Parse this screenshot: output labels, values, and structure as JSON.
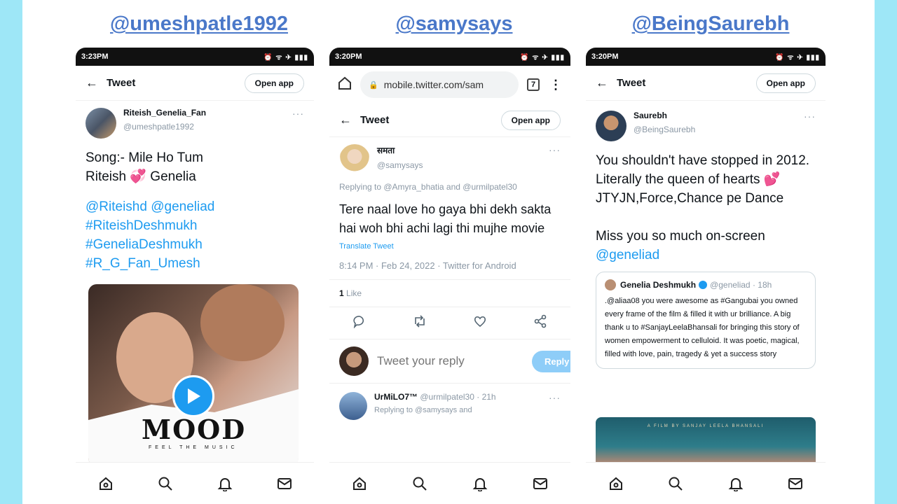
{
  "handles": [
    "@umeshpatle1992",
    "@samysays",
    "@BeingSaurebh"
  ],
  "colors": {
    "page_bg": "#9ee7f7",
    "link": "#1d9bf0",
    "handle": "#4a78c9"
  },
  "panel1": {
    "time": "3:23PM",
    "header": {
      "title": "Tweet",
      "open_app": "Open app",
      "back": "←"
    },
    "author": {
      "name": "Riteish_Genelia_Fan",
      "username": "@umeshpatle1992"
    },
    "more": "···",
    "body_text": "Song:- Mile Ho Tum\nRiteish 💞 Genelia",
    "links": [
      "@Riteishd @geneliad",
      "#RiteishDeshmukh",
      "#GeneliaDeshmukh",
      "#R_G_Fan_Umesh"
    ],
    "media": {
      "title": "MOOD",
      "subtitle": "FEEL THE MUSIC",
      "play_icon": "play-icon"
    }
  },
  "panel2": {
    "time": "3:20PM",
    "browser": {
      "url": "mobile.twitter.com/sam",
      "tabs": "7"
    },
    "header": {
      "title": "Tweet",
      "open_app": "Open app",
      "back": "←"
    },
    "author": {
      "name": "समता",
      "username": "@samysays"
    },
    "more": "···",
    "reply_to": "Replying to @Amyra_bhatia and @urmilpatel30",
    "body_text": "Tere naal love ho gaya bhi dekh sakta hai woh bhi achi lagi thi mujhe movie",
    "translate": "Translate Tweet",
    "meta": "8:14 PM · Feb 24, 2022 · Twitter for Android",
    "likes_count": "1",
    "likes_label": "Like",
    "reply_placeholder": "Tweet your reply",
    "reply_button": "Reply",
    "next_tweet": {
      "name": "UrMiLO7™",
      "username": "@urmilpatel30 · 21h",
      "reply_to": "Replying to @samysays and"
    }
  },
  "panel3": {
    "time": "3:20PM",
    "header": {
      "title": "Tweet",
      "open_app": "Open app",
      "back": "←"
    },
    "author": {
      "name": "Saurebh",
      "username": "@BeingSaurebh"
    },
    "more": "···",
    "body_text": "You shouldn't have stopped in 2012.\nLiterally the queen of hearts 💕\nJTYJN,Force,Chance pe Dance\n\nMiss you so much on-screen",
    "body_link": "@geneliad",
    "quote": {
      "name": "Genelia Deshmukh",
      "username": "@geneliad · 18h",
      "text": ".@aliaa08 you were awesome as #Gangubai you owned every frame of the film & filled it with ur brilliance. A big thank u to #SanjayLeelaBhansali for bringing this story of women empowerment to celluloid. It was poetic, magical, filled with love, pain, tragedy & yet a success story"
    },
    "poster_caption": "A FILM BY SANJAY LEELA BHANSALI"
  }
}
